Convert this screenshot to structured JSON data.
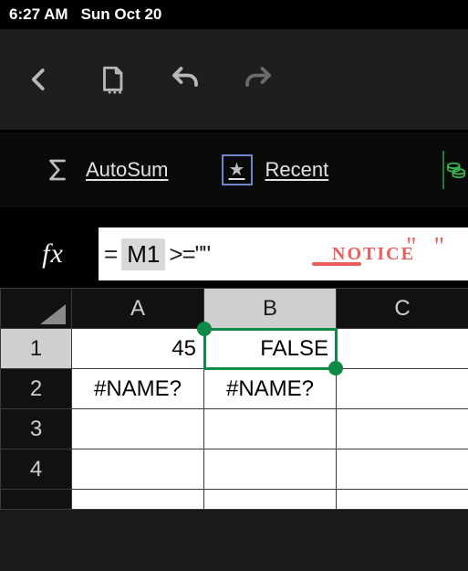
{
  "status": {
    "time": "6:27 AM",
    "date": "Sun Oct 20"
  },
  "ribbon": {
    "autosum_label": "AutoSum",
    "recent_label": "Recent"
  },
  "formula": {
    "fx_label": "fx",
    "eq": "=",
    "ref": "M1",
    "op": ">=\"\""
  },
  "annotation": {
    "text": "NOTICE",
    "quotes": "\" \""
  },
  "grid": {
    "columns": [
      "A",
      "B",
      "C"
    ],
    "rows": [
      "1",
      "2",
      "3",
      "4"
    ],
    "cells": {
      "A1": "45",
      "B1": "FALSE",
      "A2": "#NAME?",
      "B2": "#NAME?"
    },
    "selected": "B1"
  }
}
